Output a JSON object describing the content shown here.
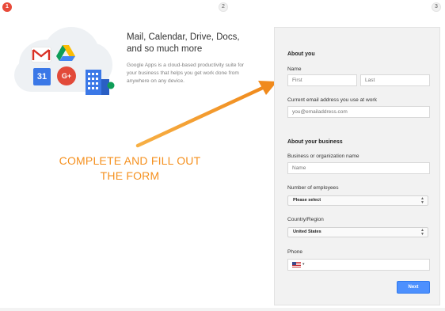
{
  "steps": [
    "1",
    "2",
    "3"
  ],
  "intro": {
    "headline_line1": "Mail, Calendar, Drive, Docs,",
    "headline_line2": "and so much more",
    "description": "Google Apps is a cloud-based productivity suite for your business that helps you get work done from anywhere on any device."
  },
  "icons": {
    "gmail": "gmail-icon",
    "drive": "drive-icon",
    "calendar": "calendar-icon",
    "calendar_day": "31",
    "gplus": "google-plus-icon",
    "gplus_label": "G+",
    "building": "building-icon"
  },
  "annotation": {
    "line1": "COMPLETE AND FILL OUT",
    "line2": "THE FORM",
    "color": "#f5901e"
  },
  "form": {
    "about_you": {
      "title": "About you",
      "name_label": "Name",
      "first_placeholder": "First",
      "last_placeholder": "Last",
      "email_label": "Current email address you use at work",
      "email_placeholder": "you@emailaddress.com"
    },
    "about_business": {
      "title": "About your business",
      "business_label": "Business or organization name",
      "business_placeholder": "Name",
      "employees_label": "Number of employees",
      "employees_value": "Please select",
      "country_label": "Country/Region",
      "country_value": "United States",
      "phone_label": "Phone",
      "phone_caret": "▾"
    },
    "next_label": "Next"
  },
  "colors": {
    "step_active": "#e84a3a",
    "next_button": "#4d90fe",
    "panel_bg": "#f2f2f2"
  }
}
